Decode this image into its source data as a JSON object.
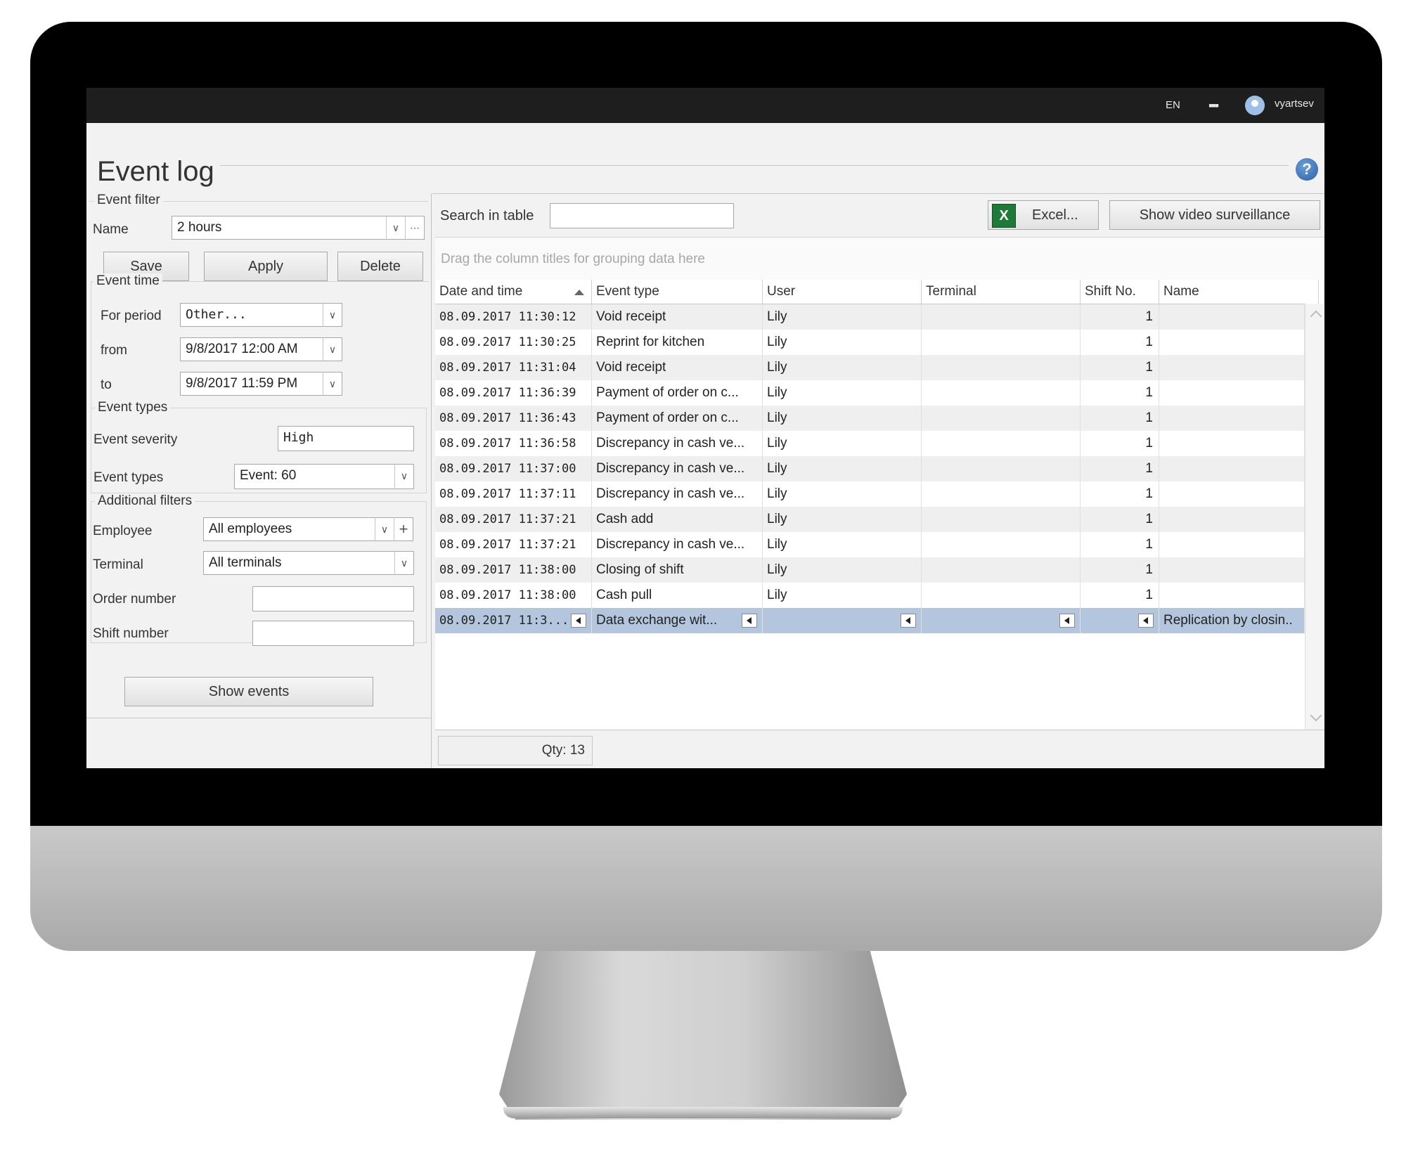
{
  "topbar": {
    "language": "EN",
    "apps_icon": "grid-icon",
    "user": "vyartsev"
  },
  "page": {
    "title": "Event log"
  },
  "filter": {
    "group_label": "Event filter",
    "name_label": "Name",
    "name_value": "2 hours",
    "save": "Save",
    "apply": "Apply",
    "delete": "Delete"
  },
  "event_time": {
    "group_label": "Event time",
    "period_label": "For period",
    "period_value": "Other...",
    "from_label": "from",
    "from_value": "9/8/2017 12:00 AM",
    "to_label": "to",
    "to_value": "9/8/2017 11:59 PM"
  },
  "event_types": {
    "group_label": "Event types",
    "severity_label": "Event severity",
    "severity_value": "High",
    "types_label": "Event types",
    "types_value": "Event: 60"
  },
  "additional": {
    "group_label": "Additional filters",
    "employee_label": "Employee",
    "employee_value": "All employees",
    "terminal_label": "Terminal",
    "terminal_value": "All terminals",
    "order_label": "Order number",
    "shift_label": "Shift number",
    "show_events": "Show events"
  },
  "toolbar": {
    "search_label": "Search in table",
    "excel": "Excel...",
    "video": "Show video surveillance",
    "group_hint": "Drag the column titles for grouping data here"
  },
  "table": {
    "columns": [
      "Date and time",
      "Event type",
      "User",
      "Terminal",
      "Shift No.",
      "Name"
    ],
    "rows": [
      [
        "08.09.2017 11:30:12",
        "Void receipt",
        "Lily",
        "",
        "1",
        ""
      ],
      [
        "08.09.2017 11:30:25",
        "Reprint for kitchen",
        "Lily",
        "",
        "1",
        ""
      ],
      [
        "08.09.2017 11:31:04",
        "Void receipt",
        "Lily",
        "",
        "1",
        ""
      ],
      [
        "08.09.2017 11:36:39",
        "Payment of order on c...",
        "Lily",
        "",
        "1",
        ""
      ],
      [
        "08.09.2017 11:36:43",
        "Payment of order on c...",
        "Lily",
        "",
        "1",
        ""
      ],
      [
        "08.09.2017 11:36:58",
        "Discrepancy in cash ve...",
        "Lily",
        "",
        "1",
        ""
      ],
      [
        "08.09.2017 11:37:00",
        "Discrepancy in cash ve...",
        "Lily",
        "",
        "1",
        ""
      ],
      [
        "08.09.2017 11:37:11",
        "Discrepancy in cash ve...",
        "Lily",
        "",
        "1",
        ""
      ],
      [
        "08.09.2017 11:37:21",
        "Cash add",
        "Lily",
        "",
        "1",
        ""
      ],
      [
        "08.09.2017 11:37:21",
        "Discrepancy in cash ve...",
        "Lily",
        "",
        "1",
        ""
      ],
      [
        "08.09.2017 11:38:00",
        "Closing of shift",
        "Lily",
        "",
        "1",
        ""
      ],
      [
        "08.09.2017 11:38:00",
        "Cash pull",
        "Lily",
        "",
        "1",
        ""
      ]
    ],
    "selected_row": [
      "08.09.2017 11:3...",
      "Data exchange wit...",
      "",
      "",
      "",
      "Replication by closin.."
    ],
    "qty": "Qty: 13"
  }
}
